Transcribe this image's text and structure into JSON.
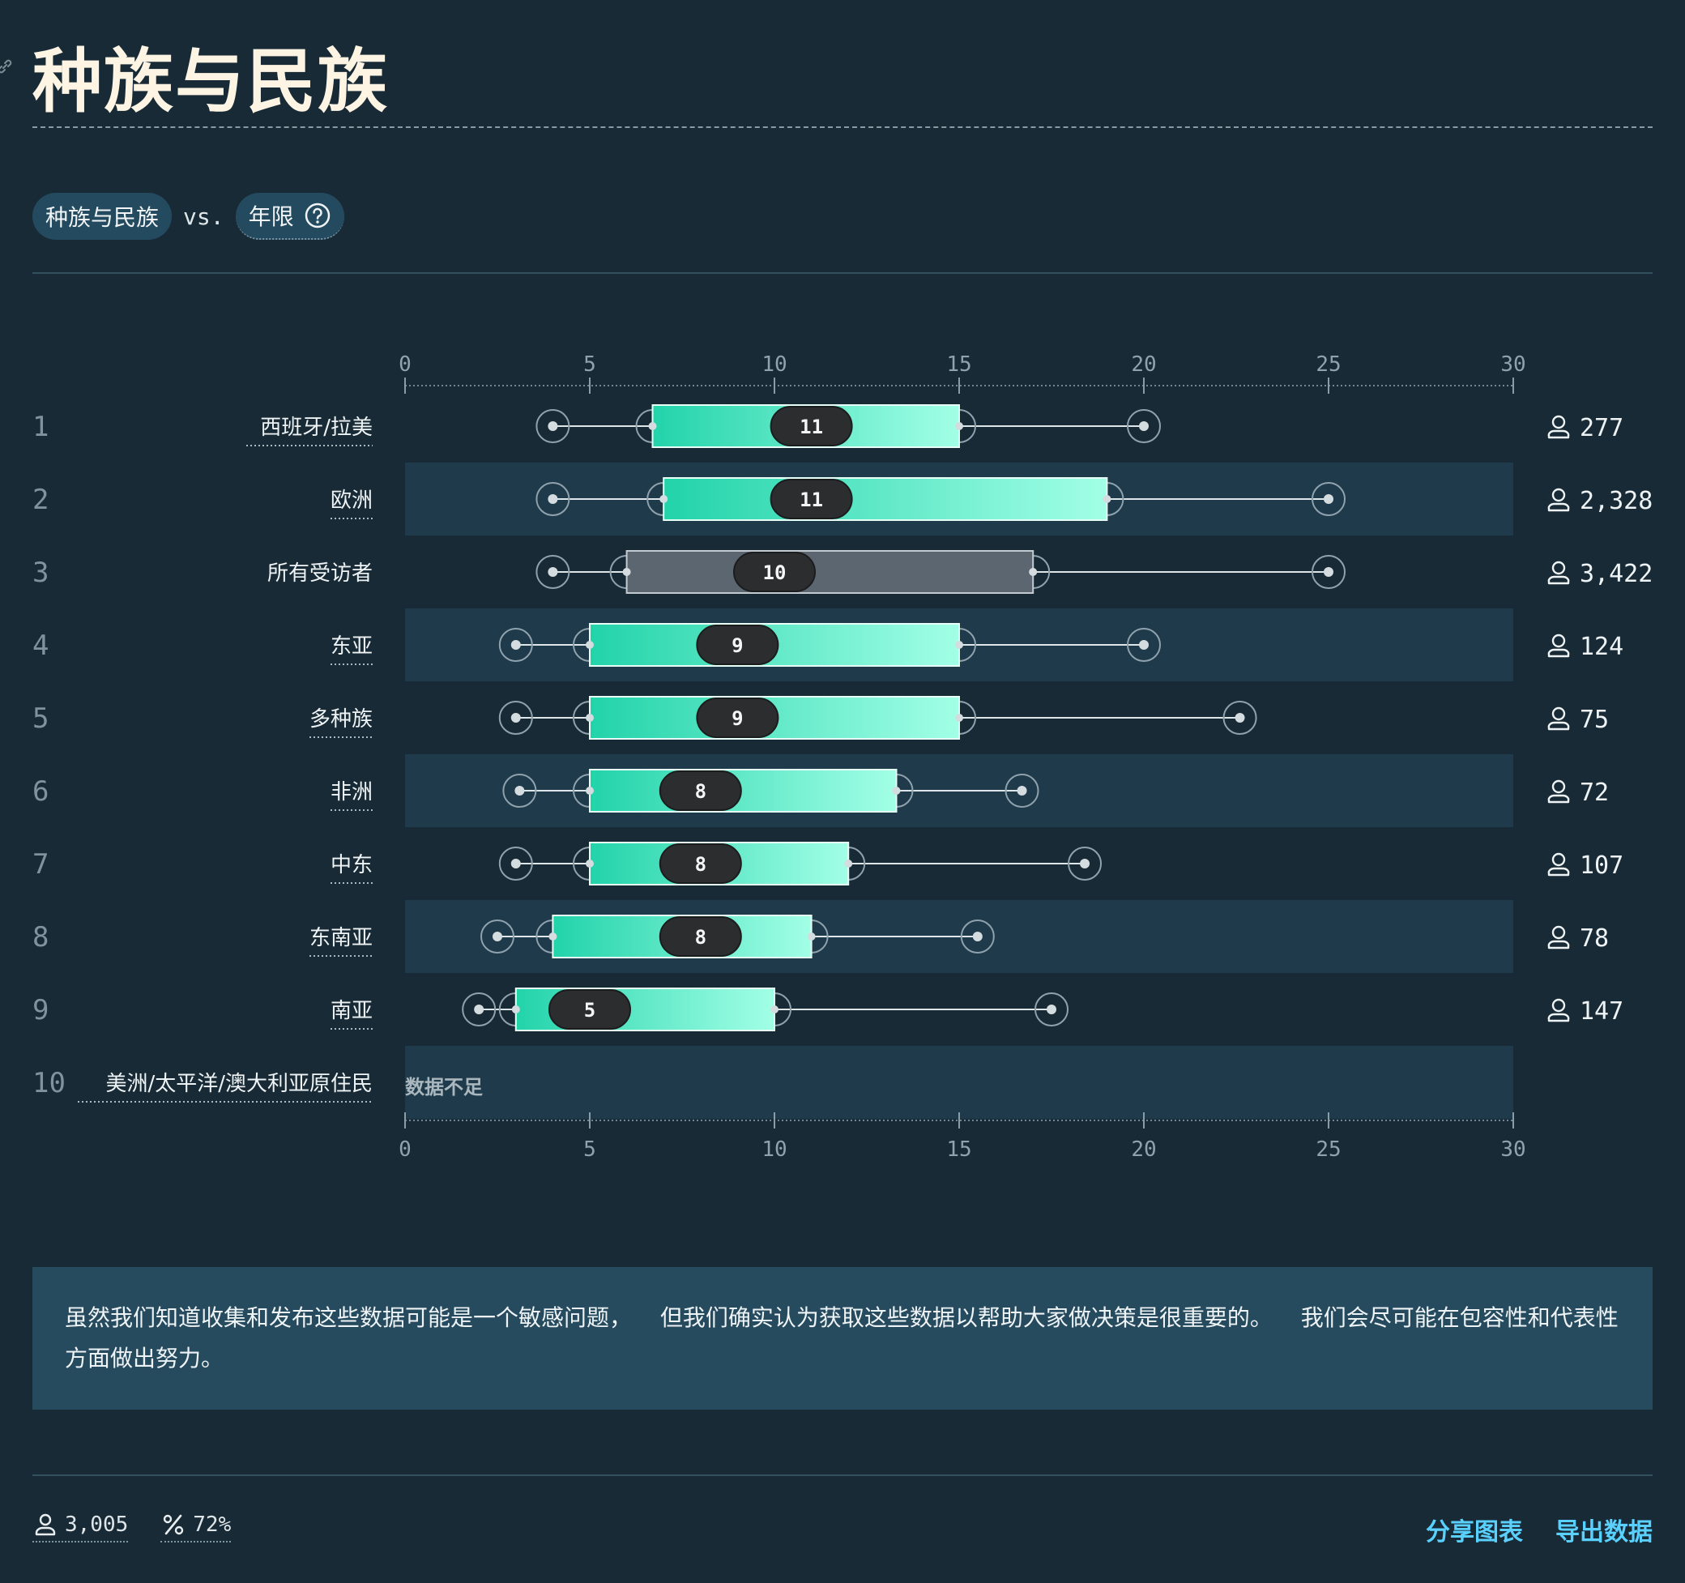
{
  "header": {
    "title": "种族与民族"
  },
  "controls": {
    "left_pill": "种族与民族",
    "vs": "vs.",
    "right_pill": "年限"
  },
  "note": {
    "text": "虽然我们知道收集和发布这些数据可能是一个敏感问题， 但我们确实认为获取这些数据以帮助大家做决策是很重要的。 我们会尽可能在包容性和代表性方面做出努力。"
  },
  "footer": {
    "respondents": "3,005",
    "percent": "72%",
    "share_label": "分享图表",
    "export_label": "导出数据"
  },
  "colors": {
    "background": "#182a35",
    "row_band": "#1f3a4a",
    "box_start": "#22d3aa",
    "box_end": "#a2ffe6",
    "highlight_box": "#5b6670",
    "median_pill": "#2b2d2f"
  },
  "chart_data": {
    "type": "box",
    "xlim": [
      0,
      30
    ],
    "ticks": [
      0,
      5,
      10,
      15,
      20,
      25,
      30
    ],
    "insufficient_label": "数据不足",
    "rows": [
      {
        "rank": "1",
        "label": "西班牙/拉美",
        "min": 4,
        "q1": 6.7,
        "median": 11,
        "q3": 15,
        "max": 20,
        "count": "277",
        "highlight": false
      },
      {
        "rank": "2",
        "label": "欧洲",
        "min": 4,
        "q1": 7,
        "median": 11,
        "q3": 19,
        "max": 25,
        "count": "2,328",
        "highlight": false
      },
      {
        "rank": "3",
        "label": "所有受访者",
        "min": 4,
        "q1": 6,
        "median": 10,
        "q3": 17,
        "max": 25,
        "count": "3,422",
        "highlight": true
      },
      {
        "rank": "4",
        "label": "东亚",
        "min": 3,
        "q1": 5,
        "median": 9,
        "q3": 15,
        "max": 20,
        "count": "124",
        "highlight": false
      },
      {
        "rank": "5",
        "label": "多种族",
        "min": 3,
        "q1": 5,
        "median": 9,
        "q3": 15,
        "max": 22.6,
        "count": "75",
        "highlight": false
      },
      {
        "rank": "6",
        "label": "非洲",
        "min": 3.1,
        "q1": 5,
        "median": 8,
        "q3": 13.3,
        "max": 16.7,
        "count": "72",
        "highlight": false
      },
      {
        "rank": "7",
        "label": "中东",
        "min": 3,
        "q1": 5,
        "median": 8,
        "q3": 12,
        "max": 18.4,
        "count": "107",
        "highlight": false
      },
      {
        "rank": "8",
        "label": "东南亚",
        "min": 2.5,
        "q1": 4,
        "median": 8,
        "q3": 11,
        "max": 15.5,
        "count": "78",
        "highlight": false
      },
      {
        "rank": "9",
        "label": "南亚",
        "min": 2,
        "q1": 3,
        "median": 5,
        "q3": 10,
        "max": 17.5,
        "count": "147",
        "highlight": false
      },
      {
        "rank": "10",
        "label": "美洲/太平洋/澳大利亚原住民",
        "insufficient": true
      }
    ]
  }
}
